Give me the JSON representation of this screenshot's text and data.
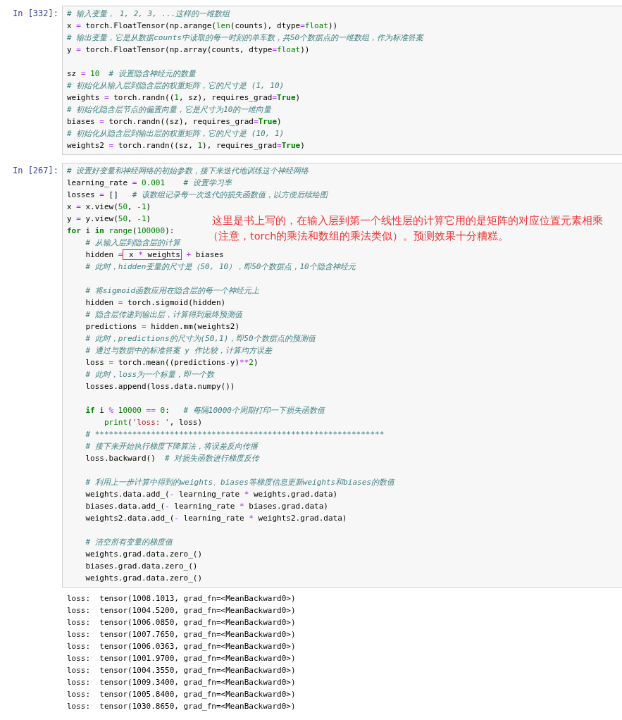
{
  "cells": [
    {
      "prompt": "In [332]:",
      "blocks": [
        {
          "lines": [
            {
              "tokens": [
                {
                  "kind": "comment",
                  "text": "# 输入变量， 1, 2, 3, ...这样的一维数组"
                }
              ]
            },
            {
              "tokens": [
                {
                  "kind": "plain",
                  "text": "x "
                },
                {
                  "kind": "operator",
                  "text": "="
                },
                {
                  "kind": "plain",
                  "text": " torch.FloatTensor(np.arange("
                },
                {
                  "kind": "builtin",
                  "text": "len"
                },
                {
                  "kind": "plain",
                  "text": "(counts), dtype"
                },
                {
                  "kind": "operator",
                  "text": "="
                },
                {
                  "kind": "builtin",
                  "text": "float"
                },
                {
                  "kind": "plain",
                  "text": "))"
                }
              ]
            },
            {
              "tokens": [
                {
                  "kind": "comment",
                  "text": "# 输出变量，它是从数据counts中读取的每一时刻的单车数，共50个数据点的一维数组，作为标准答案"
                }
              ]
            },
            {
              "tokens": [
                {
                  "kind": "plain",
                  "text": "y "
                },
                {
                  "kind": "operator",
                  "text": "="
                },
                {
                  "kind": "plain",
                  "text": " torch.FloatTensor(np.array(counts, dtype"
                },
                {
                  "kind": "operator",
                  "text": "="
                },
                {
                  "kind": "builtin",
                  "text": "float"
                },
                {
                  "kind": "plain",
                  "text": "))"
                }
              ]
            }
          ]
        },
        {
          "lines": [
            {
              "tokens": [
                {
                  "kind": "plain",
                  "text": "sz "
                },
                {
                  "kind": "operator",
                  "text": "="
                },
                {
                  "kind": "number",
                  "text": " 10"
                },
                {
                  "kind": "comment",
                  "text": "  # 设置隐含神经元的数量"
                }
              ]
            },
            {
              "tokens": [
                {
                  "kind": "comment",
                  "text": "# 初始化从输入层到隐含层的权重矩阵，它的尺寸是 (1, 10)"
                }
              ]
            },
            {
              "tokens": [
                {
                  "kind": "plain",
                  "text": "weights "
                },
                {
                  "kind": "operator",
                  "text": "="
                },
                {
                  "kind": "plain",
                  "text": " torch.randn(("
                },
                {
                  "kind": "number",
                  "text": "1"
                },
                {
                  "kind": "plain",
                  "text": ", sz), requires_grad"
                },
                {
                  "kind": "operator",
                  "text": "="
                },
                {
                  "kind": "keyword",
                  "text": "True"
                },
                {
                  "kind": "plain",
                  "text": ")"
                }
              ]
            },
            {
              "tokens": [
                {
                  "kind": "comment",
                  "text": "# 初始化隐含层节点的偏置向量，它是尺寸为10的一维向量"
                }
              ]
            },
            {
              "tokens": [
                {
                  "kind": "plain",
                  "text": "biases "
                },
                {
                  "kind": "operator",
                  "text": "="
                },
                {
                  "kind": "plain",
                  "text": " torch.randn((sz), requires_grad"
                },
                {
                  "kind": "operator",
                  "text": "="
                },
                {
                  "kind": "keyword",
                  "text": "True"
                },
                {
                  "kind": "plain",
                  "text": ")"
                }
              ]
            },
            {
              "tokens": [
                {
                  "kind": "comment",
                  "text": "# 初始化从隐含层到输出层的权重矩阵，它的尺寸是 (10, 1)"
                }
              ]
            },
            {
              "tokens": [
                {
                  "kind": "plain",
                  "text": "weights2 "
                },
                {
                  "kind": "operator",
                  "text": "="
                },
                {
                  "kind": "plain",
                  "text": " torch.randn((sz, "
                },
                {
                  "kind": "number",
                  "text": "1"
                },
                {
                  "kind": "plain",
                  "text": "), requires_grad"
                },
                {
                  "kind": "operator",
                  "text": "="
                },
                {
                  "kind": "keyword",
                  "text": "True"
                },
                {
                  "kind": "plain",
                  "text": ")"
                }
              ]
            }
          ]
        }
      ]
    },
    {
      "prompt": "In [267]:",
      "annotation": [
        "这里是书上写的，在输入层到第一个线性层的计算它用的是矩阵的对应位置元素相乘",
        "（注意，torch的乘法和数组的乘法类似）。预测效果十分糟糕。"
      ],
      "blocks": [
        {
          "lines": [
            {
              "tokens": [
                {
                  "kind": "comment",
                  "text": "# 设置好变量和神经网络的初始参数，接下来迭代地训练这个神经网络"
                }
              ]
            },
            {
              "tokens": [
                {
                  "kind": "plain",
                  "text": "learning_rate "
                },
                {
                  "kind": "operator",
                  "text": "="
                },
                {
                  "kind": "number",
                  "text": " 0.001"
                },
                {
                  "kind": "comment",
                  "text": "    # 设置学习率"
                }
              ]
            },
            {
              "tokens": [
                {
                  "kind": "plain",
                  "text": "losses "
                },
                {
                  "kind": "operator",
                  "text": "="
                },
                {
                  "kind": "plain",
                  "text": " []"
                },
                {
                  "kind": "comment",
                  "text": "   # 该数组记录每一次迭代的损失函数值，以方便后续绘图"
                }
              ]
            },
            {
              "tokens": [
                {
                  "kind": "plain",
                  "text": "x "
                },
                {
                  "kind": "operator",
                  "text": "="
                },
                {
                  "kind": "plain",
                  "text": " x.view("
                },
                {
                  "kind": "number",
                  "text": "50"
                },
                {
                  "kind": "plain",
                  "text": ","
                },
                {
                  "kind": "operator",
                  "text": " -"
                },
                {
                  "kind": "number",
                  "text": "1"
                },
                {
                  "kind": "plain",
                  "text": ")"
                }
              ]
            },
            {
              "tokens": [
                {
                  "kind": "plain",
                  "text": "y "
                },
                {
                  "kind": "operator",
                  "text": "="
                },
                {
                  "kind": "plain",
                  "text": " y.view("
                },
                {
                  "kind": "number",
                  "text": "50"
                },
                {
                  "kind": "plain",
                  "text": ","
                },
                {
                  "kind": "operator",
                  "text": " -"
                },
                {
                  "kind": "number",
                  "text": "1"
                },
                {
                  "kind": "plain",
                  "text": ")"
                }
              ]
            },
            {
              "tokens": [
                {
                  "kind": "keyword",
                  "text": "for"
                },
                {
                  "kind": "plain",
                  "text": " i"
                },
                {
                  "kind": "keyword",
                  "text": " in"
                },
                {
                  "kind": "builtin",
                  "text": " range"
                },
                {
                  "kind": "plain",
                  "text": "("
                },
                {
                  "kind": "number",
                  "text": "100000"
                },
                {
                  "kind": "plain",
                  "text": "):"
                }
              ]
            },
            {
              "tokens": [
                {
                  "kind": "comment",
                  "text": "    # 从输入层到隐含层的计算"
                }
              ]
            },
            {
              "tokens": [
                {
                  "kind": "plain",
                  "text": "    hidden ",
                  "highlighted": false
                },
                {
                  "kind": "operator",
                  "text": "=",
                  "highlighted": false
                },
                {
                  "kind": "plain",
                  "text": " x",
                  "highlighted": true
                },
                {
                  "kind": "operator",
                  "text": " *",
                  "highlighted": true
                },
                {
                  "kind": "plain",
                  "text": " weights",
                  "highlighted": true
                },
                {
                  "kind": "operator",
                  "text": " +",
                  "highlighted": false
                },
                {
                  "kind": "plain",
                  "text": " biases",
                  "highlighted": false
                }
              ]
            },
            {
              "tokens": [
                {
                  "kind": "comment",
                  "text": "    # 此时，hidden变量的尺寸是（50, 10），即50个数据点，10个隐含神经元"
                }
              ]
            }
          ]
        },
        {
          "lines": [
            {
              "tokens": [
                {
                  "kind": "comment",
                  "text": "    # 将sigmoid函数应用在隐含层的每一个神经元上"
                }
              ]
            },
            {
              "tokens": [
                {
                  "kind": "plain",
                  "text": "    hidden "
                },
                {
                  "kind": "operator",
                  "text": "="
                },
                {
                  "kind": "plain",
                  "text": " torch.sigmoid(hidden)"
                }
              ]
            },
            {
              "tokens": [
                {
                  "kind": "comment",
                  "text": "    # 隐含层传递到输出层，计算得到最终预测值"
                }
              ]
            },
            {
              "tokens": [
                {
                  "kind": "plain",
                  "text": "    predictions "
                },
                {
                  "kind": "operator",
                  "text": "="
                },
                {
                  "kind": "plain",
                  "text": " hidden.mm(weights2)"
                }
              ]
            },
            {
              "tokens": [
                {
                  "kind": "comment",
                  "text": "    # 此时，predictions的尺寸为(50,1)，即50个数据点的预测值"
                }
              ]
            },
            {
              "tokens": [
                {
                  "kind": "comment",
                  "text": "    # 通过与数据中的标准答案 y 作比较，计算均方误差"
                }
              ]
            },
            {
              "tokens": [
                {
                  "kind": "plain",
                  "text": "    loss "
                },
                {
                  "kind": "operator",
                  "text": "="
                },
                {
                  "kind": "plain",
                  "text": " torch.mean((predictions"
                },
                {
                  "kind": "operator",
                  "text": "-"
                },
                {
                  "kind": "plain",
                  "text": "y)"
                },
                {
                  "kind": "operator",
                  "text": "**"
                },
                {
                  "kind": "number",
                  "text": "2"
                },
                {
                  "kind": "plain",
                  "text": ")"
                }
              ]
            },
            {
              "tokens": [
                {
                  "kind": "comment",
                  "text": "    # 此时，loss为一个标量，即一个数"
                }
              ]
            },
            {
              "tokens": [
                {
                  "kind": "plain",
                  "text": "    losses.append(loss.data.numpy())"
                }
              ]
            }
          ]
        },
        {
          "lines": [
            {
              "tokens": [
                {
                  "kind": "keyword",
                  "text": "    if"
                },
                {
                  "kind": "plain",
                  "text": " i"
                },
                {
                  "kind": "operator",
                  "text": " %"
                },
                {
                  "kind": "number",
                  "text": " 10000"
                },
                {
                  "kind": "operator",
                  "text": " =="
                },
                {
                  "kind": "number",
                  "text": " 0"
                },
                {
                  "kind": "plain",
                  "text": ":"
                },
                {
                  "kind": "comment",
                  "text": "   # 每隔10000个周期打印一下损失函数值"
                }
              ]
            },
            {
              "tokens": [
                {
                  "kind": "builtin",
                  "text": "        print"
                },
                {
                  "kind": "plain",
                  "text": "("
                },
                {
                  "kind": "string",
                  "text": "'loss: '"
                },
                {
                  "kind": "plain",
                  "text": ", loss)"
                }
              ]
            },
            {
              "tokens": [
                {
                  "kind": "comment",
                  "text": "    # **************************************************************"
                }
              ]
            },
            {
              "tokens": [
                {
                  "kind": "comment",
                  "text": "    # 接下来开始执行梯度下降算法，将误差反向传播"
                }
              ]
            },
            {
              "tokens": [
                {
                  "kind": "plain",
                  "text": "    loss.backward()"
                },
                {
                  "kind": "comment",
                  "text": "  # 对损失函数进行梯度反传"
                }
              ]
            }
          ]
        },
        {
          "lines": [
            {
              "tokens": [
                {
                  "kind": "comment",
                  "text": "    # 利用上一步计算中得到的weights、biases等梯度信息更新weights和biases的数值"
                }
              ]
            },
            {
              "tokens": [
                {
                  "kind": "plain",
                  "text": "    weights.data.add_("
                },
                {
                  "kind": "operator",
                  "text": "-"
                },
                {
                  "kind": "plain",
                  "text": " learning_rate"
                },
                {
                  "kind": "operator",
                  "text": " *"
                },
                {
                  "kind": "plain",
                  "text": " weights.grad.data)"
                }
              ]
            },
            {
              "tokens": [
                {
                  "kind": "plain",
                  "text": "    biases.data.add_("
                },
                {
                  "kind": "operator",
                  "text": "-"
                },
                {
                  "kind": "plain",
                  "text": " learning_rate"
                },
                {
                  "kind": "operator",
                  "text": " *"
                },
                {
                  "kind": "plain",
                  "text": " biases.grad.data)"
                }
              ]
            },
            {
              "tokens": [
                {
                  "kind": "plain",
                  "text": "    weights2.data.add_("
                },
                {
                  "kind": "operator",
                  "text": "-"
                },
                {
                  "kind": "plain",
                  "text": " learning_rate"
                },
                {
                  "kind": "operator",
                  "text": " *"
                },
                {
                  "kind": "plain",
                  "text": " weights2.grad.data)"
                }
              ]
            }
          ]
        },
        {
          "lines": [
            {
              "tokens": [
                {
                  "kind": "comment",
                  "text": "    # 清空所有变量的梯度值"
                }
              ]
            },
            {
              "tokens": [
                {
                  "kind": "plain",
                  "text": "    weights.grad.data.zero_()"
                }
              ]
            },
            {
              "tokens": [
                {
                  "kind": "plain",
                  "text": "    biases.grad.data.zero_()"
                }
              ]
            },
            {
              "tokens": [
                {
                  "kind": "plain",
                  "text": "    weights.grad.data.zero_()"
                }
              ]
            }
          ]
        }
      ],
      "output": [
        "loss:  tensor(1008.1013, grad_fn=<MeanBackward0>)",
        "loss:  tensor(1004.5200, grad_fn=<MeanBackward0>)",
        "loss:  tensor(1006.0850, grad_fn=<MeanBackward0>)",
        "loss:  tensor(1007.7650, grad_fn=<MeanBackward0>)",
        "loss:  tensor(1006.0363, grad_fn=<MeanBackward0>)",
        "loss:  tensor(1001.9700, grad_fn=<MeanBackward0>)",
        "loss:  tensor(1004.3550, grad_fn=<MeanBackward0>)",
        "loss:  tensor(1009.3400, grad_fn=<MeanBackward0>)",
        "loss:  tensor(1005.8400, grad_fn=<MeanBackward0>)",
        "loss:  tensor(1030.8650, grad_fn=<MeanBackward0>)"
      ]
    }
  ]
}
